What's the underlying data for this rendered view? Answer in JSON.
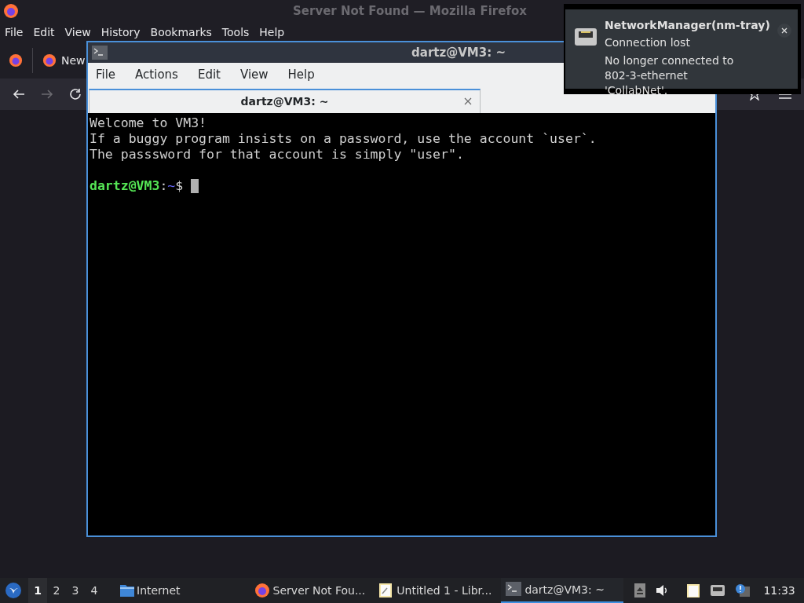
{
  "firefox": {
    "title": "Server Not Found — Mozilla Firefox",
    "menu": [
      "File",
      "Edit",
      "View",
      "History",
      "Bookmarks",
      "Tools",
      "Help"
    ],
    "tab": {
      "label": "New"
    }
  },
  "terminal": {
    "title": "dartz@VM3: ~",
    "menu": [
      "File",
      "Actions",
      "Edit",
      "View",
      "Help"
    ],
    "tabs": [
      {
        "label": "dartz@VM3: ~",
        "selected": true
      }
    ],
    "lines": [
      "Welcome to VM3!",
      "If a buggy program insists on a password, use the account `user`.",
      "The passsword for that account is simply \"user\"."
    ],
    "prompt": {
      "user_host": "dartz@VM3",
      "separator": ":",
      "path": "~",
      "symbol": "$"
    }
  },
  "notification": {
    "app": "NetworkManager(nm-tray)",
    "summary": "Connection lost",
    "body": "No longer connected to 802-3-ethernet 'CollabNet'."
  },
  "taskbar": {
    "workspaces": [
      {
        "label": "1",
        "selected": true
      },
      {
        "label": "2",
        "selected": false
      },
      {
        "label": "3",
        "selected": false
      },
      {
        "label": "4",
        "selected": false
      }
    ],
    "launcher": {
      "label": "Internet"
    },
    "tasks": [
      {
        "kind": "firefox",
        "label": "Server Not Fou...",
        "selected": false
      },
      {
        "kind": "document",
        "label": "Untitled 1 - Libr...",
        "selected": false
      },
      {
        "kind": "terminal",
        "label": "dartz@VM3: ~",
        "selected": true
      }
    ],
    "clock": "11:33"
  }
}
